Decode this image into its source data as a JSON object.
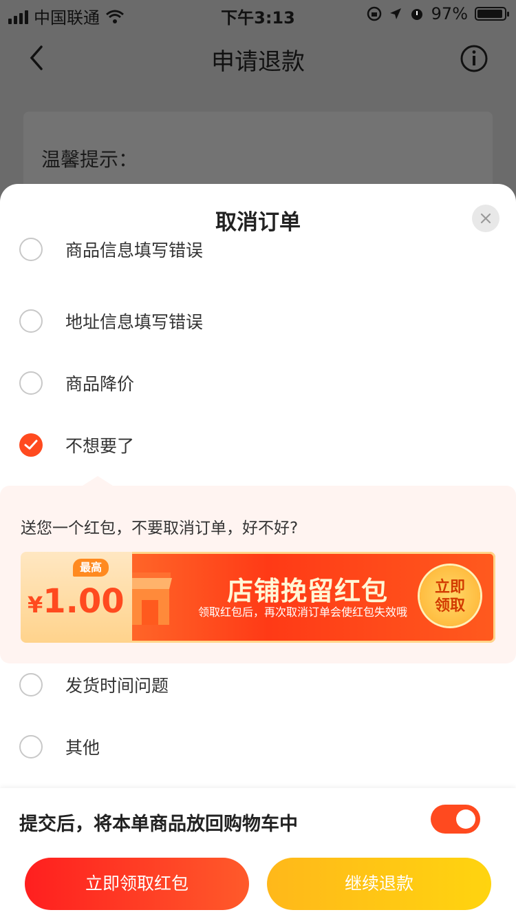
{
  "status_bar": {
    "carrier": "中国联通",
    "time": "下午3:13",
    "battery": "97%"
  },
  "nav": {
    "title": "申请退款"
  },
  "background": {
    "tip": "温馨提示："
  },
  "sheet": {
    "title": "取消订单",
    "reasons": [
      {
        "label": "商品信息填写错误",
        "checked": false
      },
      {
        "label": "地址信息填写错误",
        "checked": false
      },
      {
        "label": "商品降价",
        "checked": false
      },
      {
        "label": "不想要了",
        "checked": true
      },
      {
        "label": "发货时间问题",
        "checked": false
      },
      {
        "label": "其他",
        "checked": false
      }
    ],
    "promo": {
      "text": "送您一个红包，不要取消订单，好不好?",
      "coupon": {
        "badge": "最高",
        "currency": "¥",
        "amount": "1.00",
        "title": "店铺挽留红包",
        "subtitle": "领取红包后，再次取消订单会使红包失效哦",
        "claim_line1": "立即",
        "claim_line2": "领取"
      }
    },
    "footer": {
      "cart_text": "提交后，将本单商品放回购物车中",
      "toggle_on": true,
      "claim_button": "立即领取红包",
      "continue_button": "继续退款"
    }
  },
  "colors": {
    "accent": "#ff4a1f",
    "yellow": "#ffc30f"
  }
}
